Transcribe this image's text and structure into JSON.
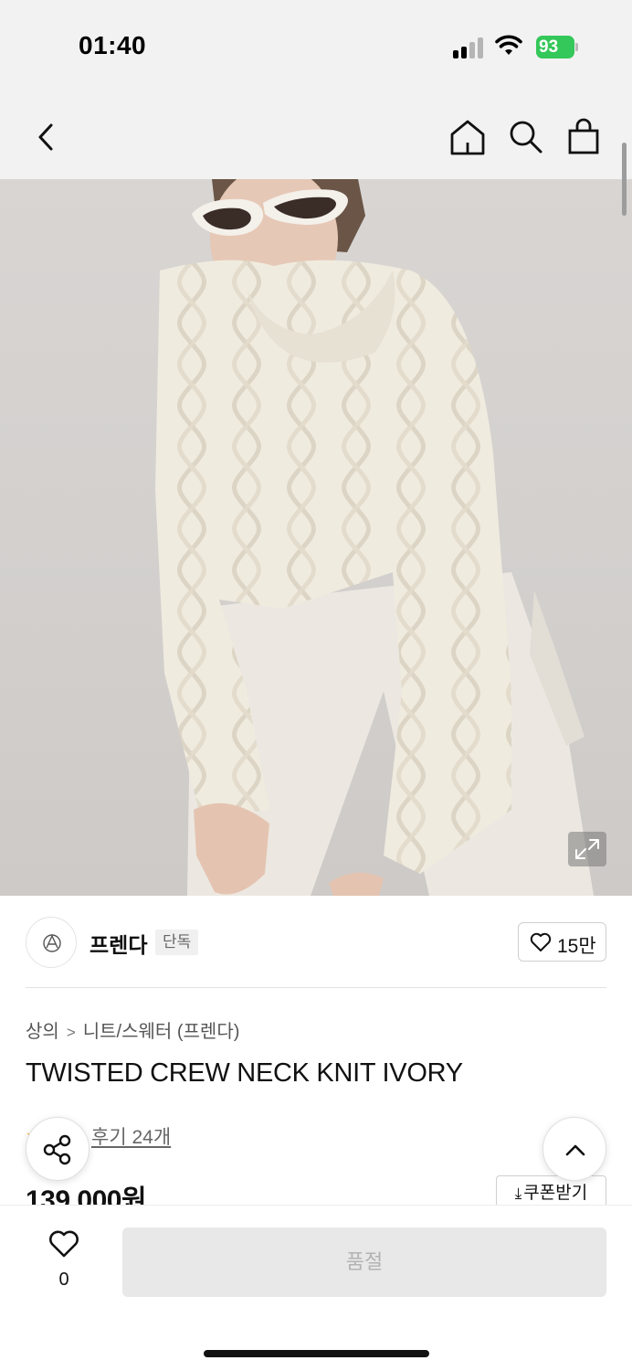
{
  "status_bar": {
    "time": "01:40",
    "battery_level": "93",
    "signal_bars_active": 2,
    "signal_bars_total": 4
  },
  "header": {
    "icons": [
      "back-icon",
      "home-icon",
      "search-icon",
      "shopping-bag-icon"
    ]
  },
  "product": {
    "image_description_icon": "expand-icon",
    "brand": {
      "name": "프렌다",
      "badge": "단독",
      "likes": "15만"
    },
    "breadcrumb": {
      "category": "상의",
      "separator": ">",
      "subcategory": "니트/스웨터 (프렌다)"
    },
    "title": "TWISTED CREW NECK KNIT IVORY",
    "review_link": "후기 24개",
    "price": "139,000원",
    "coupon_label": "쿠폰받기"
  },
  "bottom_bar": {
    "wish_count": "0",
    "purchase_button_label": "품절"
  },
  "colors": {
    "battery": "#34c759",
    "star": "#f5a623",
    "disabled_button_bg": "#e8e8e8",
    "disabled_button_text": "#b3b3b3",
    "sweater": "#f1ece0",
    "backdrop": "#d4d1cf"
  }
}
